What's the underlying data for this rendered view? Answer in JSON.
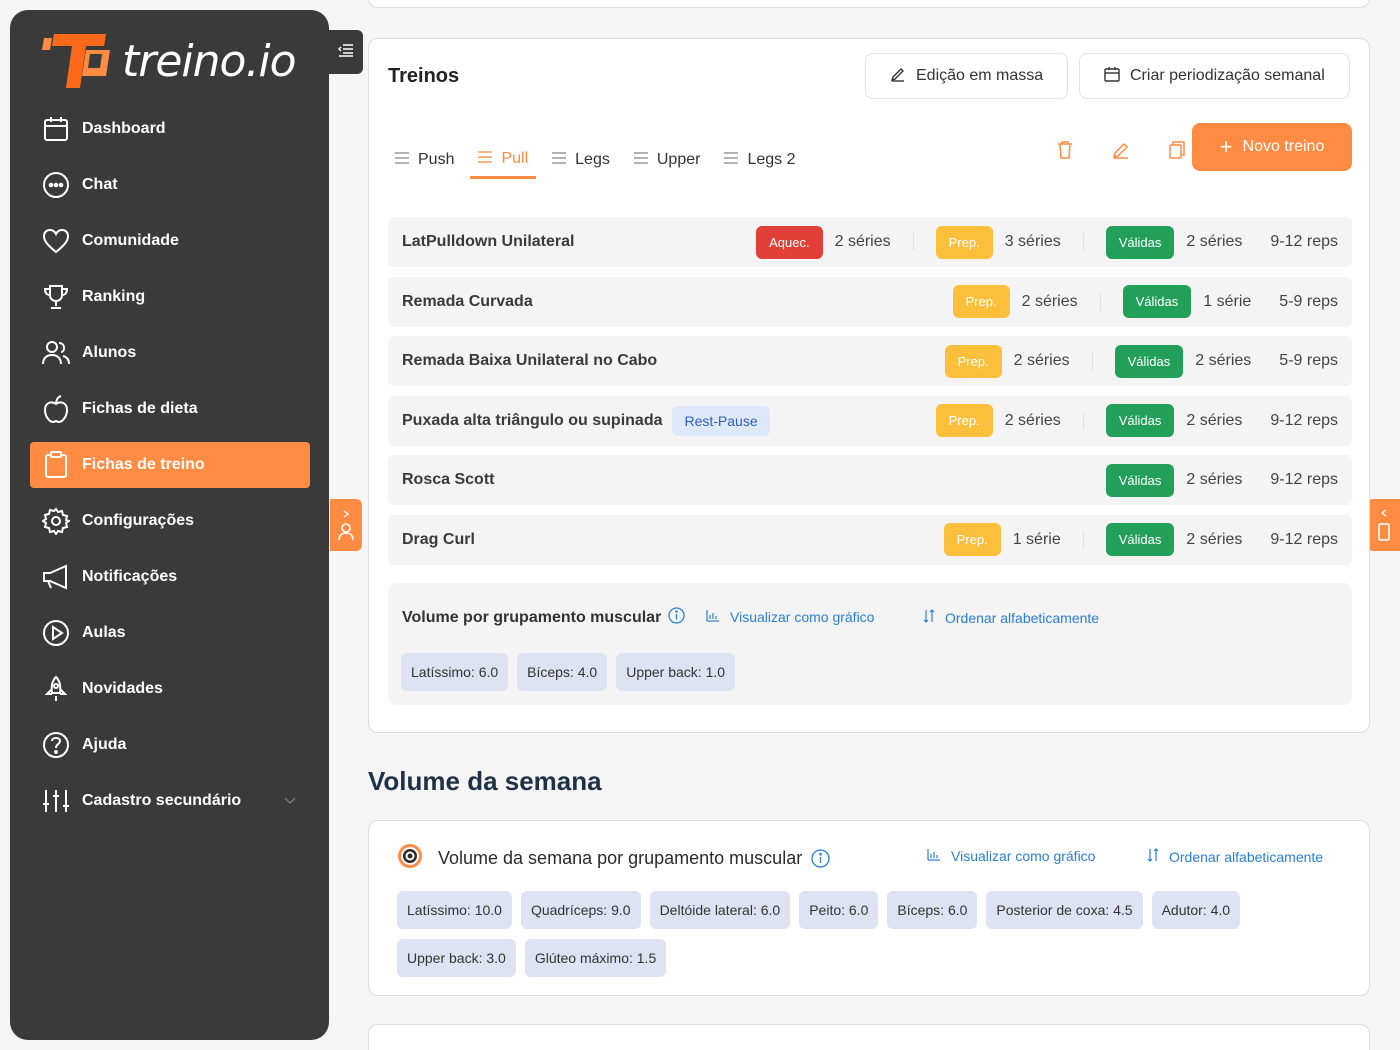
{
  "brand": {
    "name": "treino.io",
    "accent": "#ff8c42",
    "sidebar_bg": "#3a3a3a"
  },
  "sidebar": {
    "items": [
      {
        "label": "Dashboard",
        "icon": "calendar-icon"
      },
      {
        "label": "Chat",
        "icon": "chat-icon"
      },
      {
        "label": "Comunidade",
        "icon": "heart-icon"
      },
      {
        "label": "Ranking",
        "icon": "trophy-icon"
      },
      {
        "label": "Alunos",
        "icon": "users-icon"
      },
      {
        "label": "Fichas de dieta",
        "icon": "apple-icon"
      },
      {
        "label": "Fichas de treino",
        "icon": "clipboard-icon",
        "active": true
      },
      {
        "label": "Configurações",
        "icon": "gear-icon"
      },
      {
        "label": "Notificações",
        "icon": "megaphone-icon"
      },
      {
        "label": "Aulas",
        "icon": "play-icon"
      },
      {
        "label": "Novidades",
        "icon": "rocket-icon"
      },
      {
        "label": "Ajuda",
        "icon": "help-icon"
      },
      {
        "label": "Cadastro secundário",
        "icon": "sliders-icon"
      }
    ]
  },
  "treinos": {
    "title": "Treinos",
    "bulk_edit": "Edição em massa",
    "create_periodization": "Criar periodização semanal",
    "new_button": "Novo treino",
    "tabs": [
      "Push",
      "Pull",
      "Legs",
      "Upper",
      "Legs 2"
    ],
    "active_tab": "Pull",
    "exercises": [
      {
        "name": "LatPulldown Unilateral",
        "aquec": "Aquec.",
        "aquec_count": "2 séries",
        "prep": "Prep.",
        "prep_count": "3 séries",
        "validas": "Válidas",
        "validas_count": "2 séries",
        "reps": "9-12 reps"
      },
      {
        "name": "Remada Curvada",
        "prep": "Prep.",
        "prep_count": "2 séries",
        "validas": "Válidas",
        "validas_count": "1 série",
        "reps": "5-9 reps"
      },
      {
        "name": "Remada Baixa Unilateral no Cabo",
        "prep": "Prep.",
        "prep_count": "2 séries",
        "validas": "Válidas",
        "validas_count": "2 séries",
        "reps": "5-9 reps"
      },
      {
        "name": "Puxada alta triângulo ou supinada",
        "tag": "Rest-Pause",
        "prep": "Prep.",
        "prep_count": "2 séries",
        "validas": "Válidas",
        "validas_count": "2 séries",
        "reps": "9-12 reps"
      },
      {
        "name": "Rosca Scott",
        "validas": "Válidas",
        "validas_count": "2 séries",
        "reps": "9-12 reps"
      },
      {
        "name": "Drag Curl",
        "prep": "Prep.",
        "prep_count": "1 série",
        "validas": "Válidas",
        "validas_count": "2 séries",
        "reps": "9-12 reps"
      }
    ],
    "volume": {
      "title": "Volume por grupamento muscular",
      "chart_link": "Visualizar como gráfico",
      "sort_link": "Ordenar alfabeticamente",
      "chips": [
        "Latíssimo: 6.0",
        "Bíceps: 4.0",
        "Upper back: 1.0"
      ]
    }
  },
  "semana": {
    "section_title": "Volume da semana",
    "card_title": "Volume da semana por grupamento muscular",
    "chart_link": "Visualizar como gráfico",
    "sort_link": "Ordenar alfabeticamente",
    "chips": [
      "Latíssimo: 10.0",
      "Quadríceps: 9.0",
      "Deltóide lateral: 6.0",
      "Peito: 6.0",
      "Bíceps: 6.0",
      "Posterior de coxa: 4.5",
      "Adutor: 4.0",
      "Upper back: 3.0",
      "Glúteo máximo: 1.5"
    ]
  }
}
